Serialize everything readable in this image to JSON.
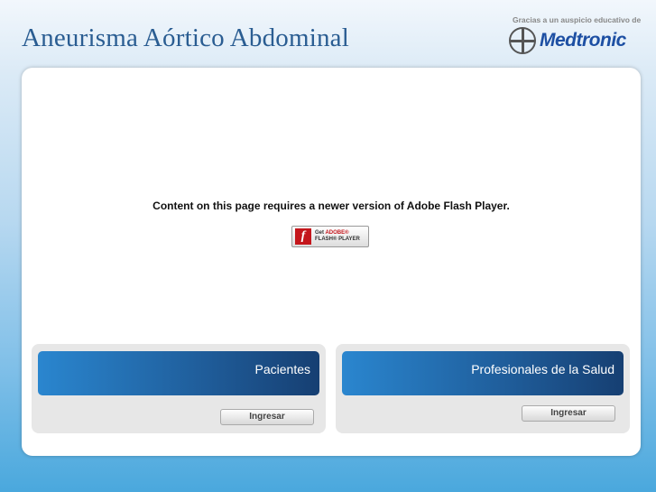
{
  "header": {
    "title": "Aneurisma Aórtico Abdominal",
    "sponsor_text": "Gracias a un auspicio educativo de",
    "logo_text": "Medtronic"
  },
  "main": {
    "flash_message": "Content on this page requires a newer version of Adobe Flash Player.",
    "flash_badge": {
      "get": "Get",
      "adobe": "ADOBE®",
      "product": "FLASH® PLAYER"
    }
  },
  "panels": [
    {
      "title": "Pacientes",
      "button": "Ingresar"
    },
    {
      "title": "Profesionales de la Salud",
      "button": "Ingresar"
    }
  ]
}
